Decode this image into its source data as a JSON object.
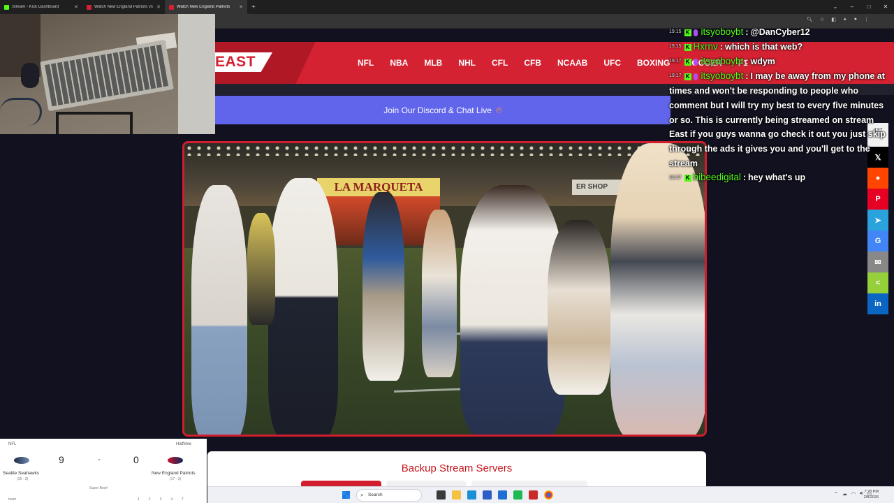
{
  "browser": {
    "tabs": [
      {
        "title": "Stream - Kick Dashboard",
        "favicon_color": "#53fc18",
        "active": false
      },
      {
        "title": "Watch New England Patriots vs",
        "favicon_color": "#d42232",
        "active": false
      },
      {
        "title": "Watch New England Patriots",
        "favicon_color": "#d42232",
        "active": true
      }
    ],
    "new_tab_label": "+"
  },
  "site": {
    "logo_text": "EAST",
    "nav": [
      "NFL",
      "NBA",
      "MLB",
      "NHL",
      "CFL",
      "CFB",
      "NCAAB",
      "UFC",
      "BOXING",
      "SOCCER",
      "F1"
    ],
    "discord_banner": "Join Our Discord & Chat Live",
    "brand_color": "#d42232",
    "discord_color": "#6165eb"
  },
  "player": {
    "sign_text": "LA MARQUETA",
    "sign2_text": "ER SHOP"
  },
  "chat": [
    {
      "time": "19:15",
      "user": "itsyoboybt",
      "mod": true,
      "text": "@DanCyber12"
    },
    {
      "time": "19:15",
      "user": "Hxrnv",
      "mod": false,
      "text": "which is that web?"
    },
    {
      "time": "19:17",
      "user": "itsyoboybt",
      "mod": true,
      "text": "wdym"
    },
    {
      "time": "19:17",
      "user": "itsyoboybt",
      "mod": true,
      "text": "I may be away from my phone at times and won't be responding to people who comment but I will try my best to every five minutes or so. This is currently being streamed on stream East if you guys wanna go check it out you just skip through the ads it gives you and you'll get to the stream"
    },
    {
      "time": "19:27",
      "user": "hibeedigital",
      "mod": false,
      "text": "hey what's up"
    }
  ],
  "share": {
    "count": "437",
    "count_label": "Shares",
    "buttons": [
      {
        "name": "x",
        "glyph": "𝕏",
        "color": "#000000"
      },
      {
        "name": "reddit",
        "glyph": "●",
        "color": "#ff4500"
      },
      {
        "name": "pinterest",
        "glyph": "P",
        "color": "#e60023"
      },
      {
        "name": "telegram",
        "glyph": "➤",
        "color": "#2aa3dc"
      },
      {
        "name": "google",
        "glyph": "G",
        "color": "#4285f4"
      },
      {
        "name": "email",
        "glyph": "✉",
        "color": "#888888"
      },
      {
        "name": "sharethis",
        "glyph": "<",
        "color": "#95d03a"
      },
      {
        "name": "linkedin",
        "glyph": "in",
        "color": "#0a66c2"
      }
    ]
  },
  "scoreboard": {
    "league": "NFL",
    "status": "Halftime",
    "home": {
      "name": "Seattle Seahawks",
      "record": "(16 - 3)",
      "score": "9"
    },
    "away": {
      "name": "New England Patriots",
      "record": "(17 - 3)",
      "score": "0"
    },
    "separator": "-",
    "event": "Super Bowl",
    "bottom_left": "team",
    "quarters": [
      "1",
      "2",
      "3",
      "4",
      "T"
    ]
  },
  "backup": {
    "title": "Backup Stream Servers"
  },
  "taskbar": {
    "search_placeholder": "Search",
    "time": "7:28 PM",
    "date": "2/8/2026"
  }
}
